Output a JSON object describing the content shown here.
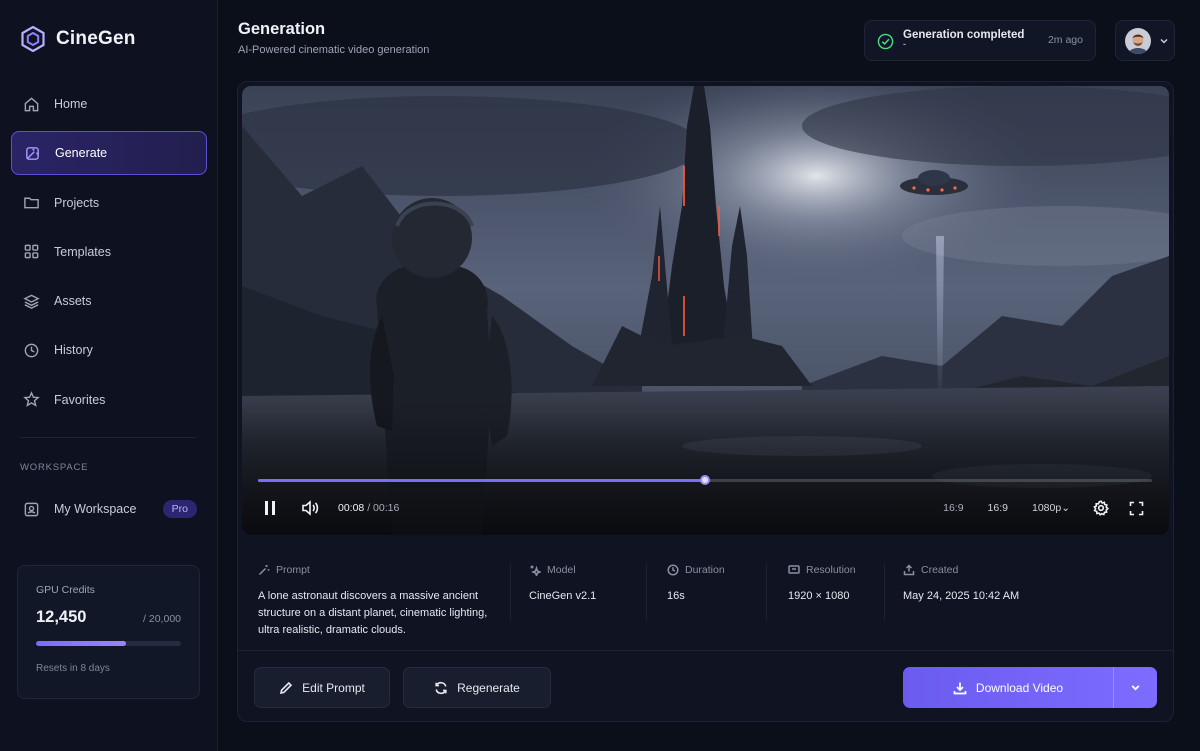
{
  "brand": {
    "name": "CineGen"
  },
  "sidebar": {
    "items": [
      {
        "label": "Home",
        "icon": "home-icon"
      },
      {
        "label": "Generate",
        "icon": "wand-icon",
        "active": true
      },
      {
        "label": "Projects",
        "icon": "folder-icon"
      },
      {
        "label": "Templates",
        "icon": "grid-icon"
      },
      {
        "label": "Assets",
        "icon": "layers-icon"
      },
      {
        "label": "History",
        "icon": "clock-icon"
      },
      {
        "label": "Favorites",
        "icon": "star-icon"
      }
    ],
    "workspace_label": "WORKSPACE",
    "workspace": {
      "label": "My Workspace",
      "badge": "Pro",
      "icon": "workspace-icon"
    },
    "credits": {
      "title": "GPU Credits",
      "value": "12,450",
      "total": "/ 20,000",
      "fraction": 0.6225,
      "reset": "Resets in 8 days"
    }
  },
  "header": {
    "title": "Generation",
    "subtitle": "AI-Powered cinematic video generation"
  },
  "notification": {
    "text": "Generation completed",
    "sub": "-",
    "time": "2m ago"
  },
  "player": {
    "current": "00:08",
    "duration": "/ 00:16",
    "progress": 0.5,
    "aspect_a": "16:9",
    "aspect_b": "16:9",
    "quality": "1080p"
  },
  "info": {
    "prompt_label": "Prompt",
    "prompt": "A lone astronaut discovers a massive ancient structure on a distant planet, cinematic lighting, ultra realistic, dramatic clouds.",
    "model_label": "Model",
    "model": "CineGen v2.1",
    "duration_label": "Duration",
    "duration": "16s",
    "resolution_label": "Resolution",
    "resolution": "1920 × 1080",
    "created_label": "Created",
    "created": "May 24, 2025 10:42 AM"
  },
  "actions": {
    "edit": "Edit Prompt",
    "regenerate": "Regenerate",
    "download": "Download Video"
  },
  "colors": {
    "accent": "#7c6cff",
    "background": "#0b0f1a",
    "success": "#4ade80"
  }
}
